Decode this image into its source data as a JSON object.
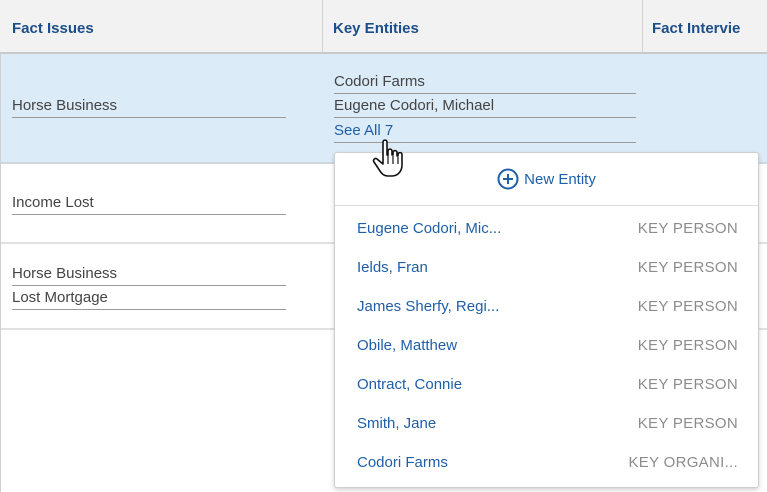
{
  "columns": [
    "Fact Issues",
    "Key Entities",
    "Fact Intervie"
  ],
  "rows": [
    {
      "fact_issues": [
        "Horse Business"
      ],
      "key_entities": [
        "Codori Farms",
        "Eugene Codori, Michael"
      ],
      "see_all_label": "See All 7",
      "selected": true
    },
    {
      "fact_issues": [
        "Income Lost"
      ]
    },
    {
      "fact_issues": [
        "Horse Business",
        "Lost Mortgage"
      ]
    }
  ],
  "dropdown": {
    "new_entity_label": "New Entity",
    "items": [
      {
        "name": "Eugene Codori, Mic...",
        "type": "KEY PERSON"
      },
      {
        "name": "Ields, Fran",
        "type": "KEY PERSON"
      },
      {
        "name": "James Sherfy, Regi...",
        "type": "KEY PERSON"
      },
      {
        "name": "Obile, Matthew",
        "type": "KEY PERSON"
      },
      {
        "name": "Ontract, Connie",
        "type": "KEY PERSON"
      },
      {
        "name": "Smith, Jane",
        "type": "KEY PERSON"
      },
      {
        "name": "Codori Farms",
        "type": "KEY ORGANI..."
      }
    ]
  },
  "colors": {
    "link": "#1f5fa8",
    "header_text": "#1c4e8a",
    "selected_row": "#dcebf8",
    "type_label": "#8c8c8c"
  },
  "icons": {
    "new_entity": "plus-circle-icon",
    "cursor": "hand-pointer-icon"
  }
}
